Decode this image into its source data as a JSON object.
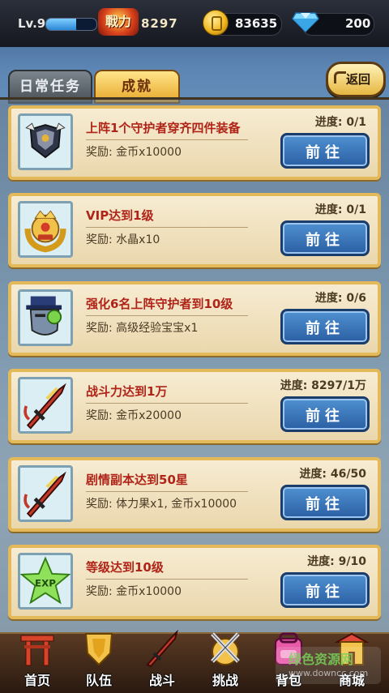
{
  "topbar": {
    "level": "Lv.9",
    "level_progress": 0.6,
    "power_icon_text": "戰力",
    "power_value": "8297",
    "coins": "83635",
    "gems": "200"
  },
  "tabs": [
    {
      "label": "日常任务",
      "active": false
    },
    {
      "label": "成就",
      "active": true
    }
  ],
  "back_label": "返回",
  "tasks": [
    {
      "icon": "armor-set-icon",
      "title": "上阵1个守护者穿齐四件装备",
      "progress": "进度: 0/1",
      "reward_label": "奖励:",
      "reward": "金币x10000",
      "button": "前往"
    },
    {
      "icon": "vip-badge-icon",
      "title": "VIP达到1级",
      "progress": "进度: 0/1",
      "reward_label": "奖励:",
      "reward": "水晶x10",
      "button": "前往"
    },
    {
      "icon": "guardian-head-icon",
      "title": "强化6名上阵守护者到10级",
      "progress": "进度: 0/6",
      "reward_label": "奖励:",
      "reward": "高级经验宝宝x1",
      "button": "前往"
    },
    {
      "icon": "sword-icon",
      "title": "战斗力达到1万",
      "progress": "进度: 8297/1万",
      "reward_label": "奖励:",
      "reward": "金币x20000",
      "button": "前往"
    },
    {
      "icon": "sword-icon",
      "title": "剧情副本达到50星",
      "progress": "进度: 46/50",
      "reward_label": "奖励:",
      "reward": "体力果x1, 金币x10000",
      "button": "前往"
    },
    {
      "icon": "exp-star-icon",
      "title": "等级达到10级",
      "progress": "进度: 9/10",
      "reward_label": "奖励:",
      "reward": "金币x10000",
      "button": "前往"
    }
  ],
  "nav": [
    {
      "icon": "home-gate-icon",
      "label": "首页"
    },
    {
      "icon": "team-shield-icon",
      "label": "队伍"
    },
    {
      "icon": "battle-sword-icon",
      "label": "战斗"
    },
    {
      "icon": "challenge-crossed-swords-icon",
      "label": "挑战"
    },
    {
      "icon": "backpack-icon",
      "label": "背包"
    },
    {
      "icon": "shop-icon",
      "label": "商城"
    }
  ],
  "watermark": {
    "line1": "绿色资源网",
    "line2": "www.downcc.com"
  }
}
